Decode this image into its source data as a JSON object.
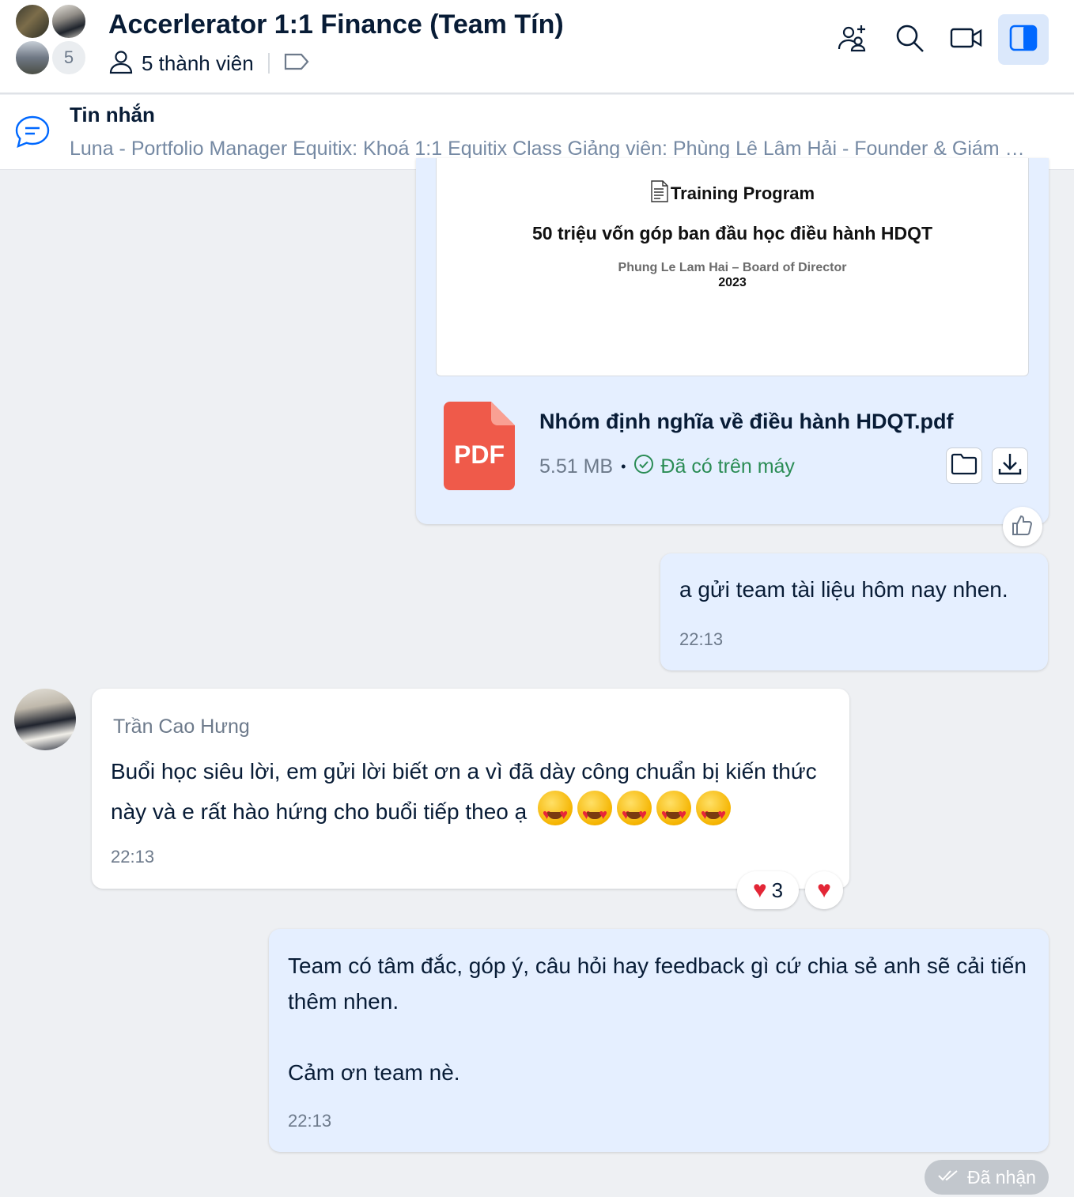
{
  "header": {
    "title": "Accerlerator 1:1 Finance (Team Tín)",
    "avatar_overflow_count": "5",
    "member_count_label": "5 thành viên",
    "icons": [
      "add-member-icon",
      "search-icon",
      "video-call-icon",
      "sidebar-toggle-icon"
    ]
  },
  "pinned": {
    "label": "Tin nhắn",
    "text": "Luna - Portfolio Manager Equitix: Khoá 1:1 Equitix Class Giảng viên: Phùng Lê Lâm Hải - Founder & Giám đốc ..."
  },
  "file_message": {
    "preview": {
      "title": "Training Program",
      "subtitle": "50 triệu vốn góp ban đầu học điều hành HDQT",
      "author": "Phung Le Lam Hai – Board of Director",
      "year": "2023"
    },
    "file_type_label": "PDF",
    "file_name": "Nhóm định nghĩa về điều hành HDQT.pdf",
    "file_size": "5.51 MB",
    "dot": "•",
    "status": "Đã có trên máy"
  },
  "messages": [
    {
      "text": "a gửi team tài liệu hôm nay nhen.",
      "time": "22:13"
    },
    {
      "sender": "Trần Cao Hưng",
      "text": "Buổi học siêu lời, em gửi lời biết ơn a vì đã dày công chuẩn bị kiến thức này và e rất hào hứng cho buổi tiếp theo ạ",
      "emoji_count": 5,
      "time": "22:13",
      "reactions": {
        "heart_count": "3"
      }
    },
    {
      "text_lines": [
        "Team có tâm đắc, góp ý, câu hỏi hay feedback gì cứ chia sẻ anh sẽ cải tiến thêm nhen.",
        "Cảm ơn team nè."
      ],
      "time": "22:13"
    }
  ],
  "received_status": "Đã nhận",
  "colors": {
    "accent": "#0068ff",
    "self_bubble": "#e5efff",
    "pdf": "#ef5a4a",
    "status_green": "#2a8c55"
  }
}
